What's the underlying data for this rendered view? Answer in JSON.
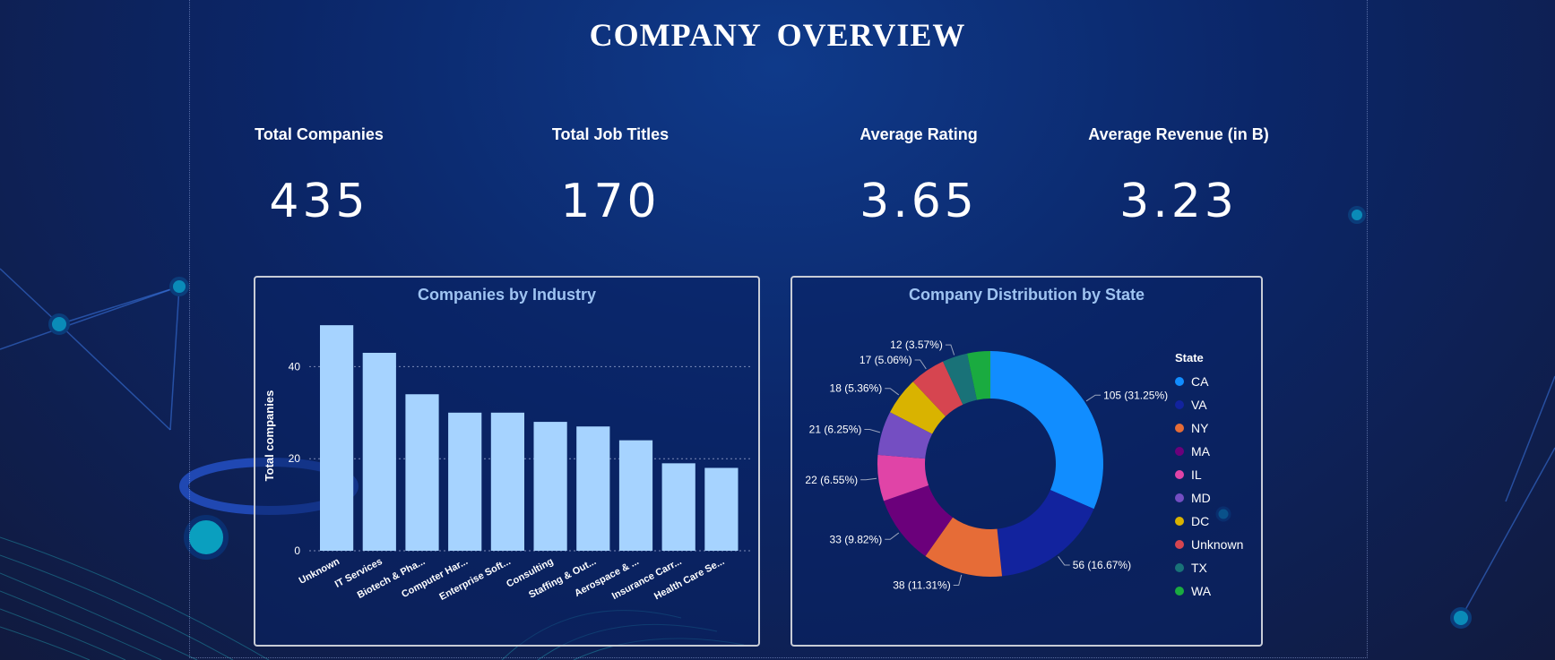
{
  "title": "COMPANY  OVERVIEW",
  "kpis": [
    {
      "label": "Total Companies",
      "value": "435"
    },
    {
      "label": "Total Job Titles",
      "value": "170"
    },
    {
      "label": "Average Rating",
      "value": "3.65"
    },
    {
      "label": "Average Revenue (in B)",
      "value": "3.23"
    }
  ],
  "chart_data": [
    {
      "type": "bar",
      "title": "Companies by Industry",
      "xlabel": "",
      "ylabel": "Total companies",
      "categories": [
        "Unknown",
        "IT Services",
        "Biotech & Pha...",
        "Computer Har...",
        "Enterprise Soft...",
        "Consulting",
        "Staffing & Out...",
        "Aerospace & ...",
        "Insurance Carr...",
        "Health Care Se..."
      ],
      "values": [
        49,
        43,
        34,
        30,
        30,
        28,
        27,
        24,
        19,
        18
      ],
      "yticks": [
        0,
        20,
        40
      ],
      "ylim": [
        0,
        50
      ],
      "grid": true,
      "bar_color": "#a6d3ff"
    },
    {
      "type": "pie",
      "title": "Company Distribution by State",
      "legend_title": "State",
      "legend_position": "right",
      "slices": [
        {
          "name": "CA",
          "value": 105,
          "label": "105 (31.25%)",
          "color": "#118dff"
        },
        {
          "name": "VA",
          "value": 56,
          "label": "56 (16.67%)",
          "color": "#12239e"
        },
        {
          "name": "NY",
          "value": 38,
          "label": "38 (11.31%)",
          "color": "#e66c37"
        },
        {
          "name": "MA",
          "value": 33,
          "label": "33 (9.82%)",
          "color": "#6b007b"
        },
        {
          "name": "IL",
          "value": 22,
          "label": "22 (6.55%)",
          "color": "#e044a7"
        },
        {
          "name": "MD",
          "value": 21,
          "label": "21 (6.25%)",
          "color": "#744ec2"
        },
        {
          "name": "DC",
          "value": 18,
          "label": "18 (5.36%)",
          "color": "#d9b300"
        },
        {
          "name": "Unknown",
          "value": 17,
          "label": "17 (5.06%)",
          "color": "#d64550"
        },
        {
          "name": "TX",
          "value": 12,
          "label": "12 (3.57%)",
          "color": "#197278"
        },
        {
          "name": "WA",
          "value": 11,
          "label": "",
          "color": "#1aab40"
        }
      ]
    }
  ]
}
